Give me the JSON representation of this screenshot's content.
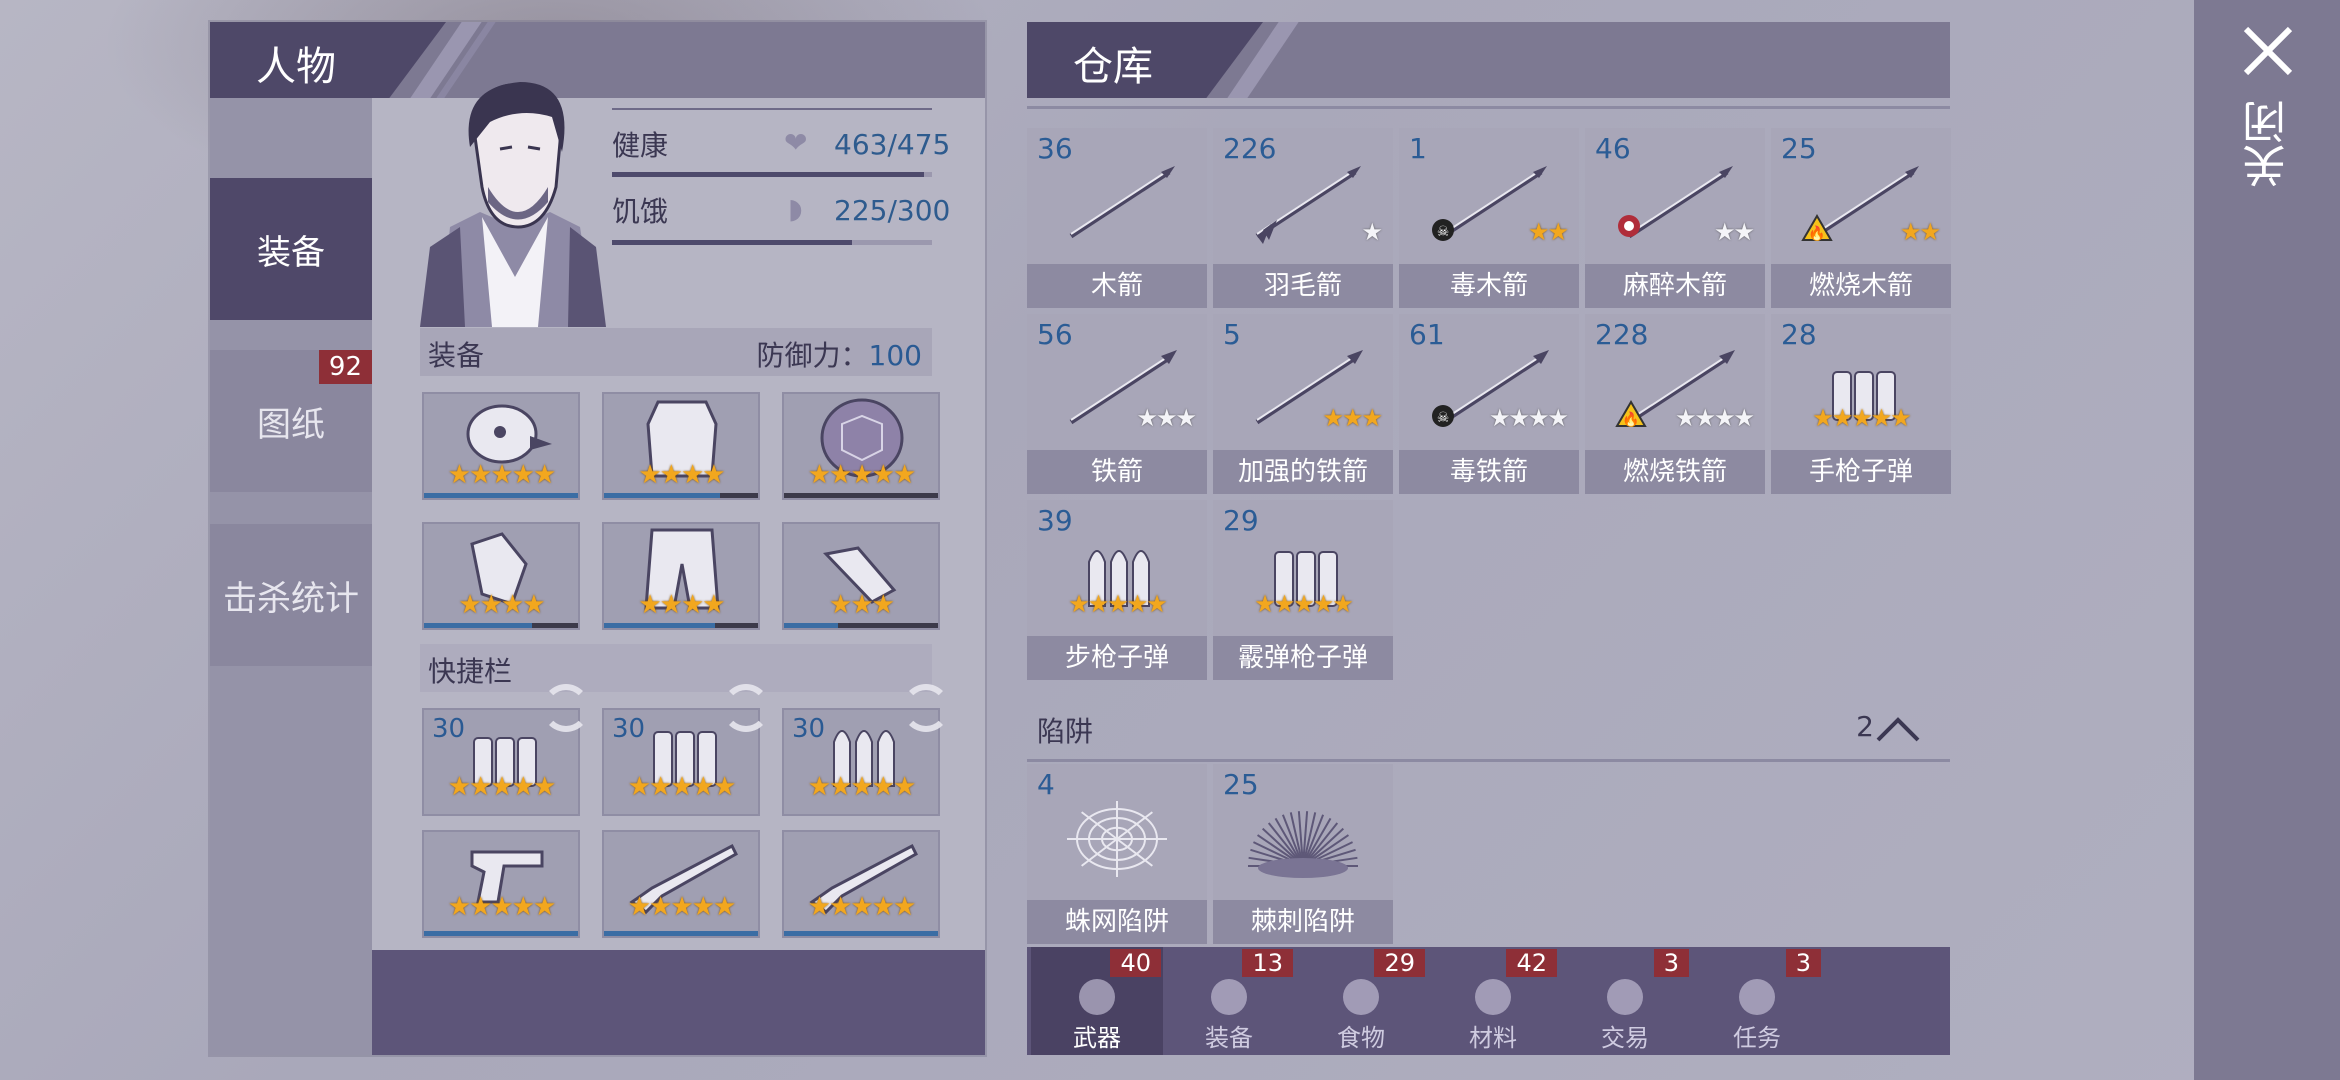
{
  "character": {
    "title": "人物",
    "tabs": [
      {
        "label": "装备",
        "active": true
      },
      {
        "label": "图纸",
        "badge": "92"
      },
      {
        "label": "击杀统计"
      }
    ],
    "health_label": "健康",
    "health_value": "463/475",
    "health_fraction": 0.975,
    "hunger_label": "饥饿",
    "hunger_value": "225/300",
    "hunger_fraction": 0.75,
    "equipment_label": "装备",
    "defense_label": "防御力：",
    "defense_value": "100",
    "quickbar_label": "快捷栏",
    "equipment_slots": [
      {
        "icon": "bird-mask-helmet-icon",
        "stars": 5,
        "durability": 1.0
      },
      {
        "icon": "vest-armor-icon",
        "stars": 4,
        "durability": 0.75
      },
      {
        "icon": "turtle-shell-icon",
        "stars": 5,
        "durability": 0.0
      },
      {
        "icon": "gloves-icon",
        "stars": 4,
        "durability": 0.7
      },
      {
        "icon": "pants-icon",
        "stars": 4,
        "durability": 0.72
      },
      {
        "icon": "boots-icon",
        "stars": 3,
        "durability": 0.35
      }
    ],
    "quick_slots": [
      {
        "count": "30",
        "icon": "pistol-ammo-icon",
        "stars": 5
      },
      {
        "count": "30",
        "icon": "shotgun-shells-icon",
        "stars": 5
      },
      {
        "count": "30",
        "icon": "rifle-ammo-icon",
        "stars": 5
      },
      {
        "icon": "revolver-icon",
        "stars": 5
      },
      {
        "icon": "shotgun-icon",
        "stars": 5
      },
      {
        "icon": "rifle-icon",
        "stars": 5
      }
    ]
  },
  "storage": {
    "title": "仓库",
    "items": [
      {
        "count": "36",
        "label": "木箭",
        "icon": "wooden-arrow-icon",
        "stars": 0
      },
      {
        "count": "226",
        "label": "羽毛箭",
        "icon": "feather-arrow-icon",
        "stars": 1,
        "star_color": "white"
      },
      {
        "count": "1",
        "label": "毒木箭",
        "icon": "poison-wooden-arrow-icon",
        "stars": 2
      },
      {
        "count": "46",
        "label": "麻醉木箭",
        "icon": "tranquilizer-arrow-icon",
        "stars": 2,
        "star_color": "white"
      },
      {
        "count": "25",
        "label": "燃烧木箭",
        "icon": "fire-wooden-arrow-icon",
        "stars": 2
      },
      {
        "count": "56",
        "label": "铁箭",
        "icon": "iron-arrow-icon",
        "stars": 3,
        "star_color": "white"
      },
      {
        "count": "5",
        "label": "加强的铁箭",
        "icon": "reinforced-iron-arrow-icon",
        "stars": 3
      },
      {
        "count": "61",
        "label": "毒铁箭",
        "icon": "poison-iron-arrow-icon",
        "stars": 4,
        "star_color": "white"
      },
      {
        "count": "228",
        "label": "燃烧铁箭",
        "icon": "fire-iron-arrow-icon",
        "stars": 4,
        "star_color": "white"
      },
      {
        "count": "28",
        "label": "手枪子弹",
        "icon": "pistol-ammo-icon",
        "stars": 5
      },
      {
        "count": "39",
        "label": "步枪子弹",
        "icon": "rifle-ammo-icon",
        "stars": 5
      },
      {
        "count": "29",
        "label": "霰弹枪子弹",
        "icon": "shotgun-shells-icon",
        "stars": 5
      }
    ],
    "traps_label": "陷阱",
    "traps_count": "2",
    "traps": [
      {
        "count": "4",
        "label": "蛛网陷阱",
        "icon": "spider-web-trap-icon"
      },
      {
        "count": "25",
        "label": "棘刺陷阱",
        "icon": "thorn-trap-icon"
      }
    ],
    "tabs": [
      {
        "label": "武器",
        "badge": "40",
        "icon": "axe-icon",
        "active": true
      },
      {
        "label": "装备",
        "badge": "13",
        "icon": "shirt-icon"
      },
      {
        "label": "食物",
        "badge": "29",
        "icon": "meat-icon"
      },
      {
        "label": "材料",
        "badge": "42",
        "icon": "wood-plank-icon"
      },
      {
        "label": "交易",
        "badge": "3",
        "icon": "coin-icon"
      },
      {
        "label": "任务",
        "badge": "3",
        "icon": "key-icon"
      }
    ]
  },
  "close_label": "关闭"
}
